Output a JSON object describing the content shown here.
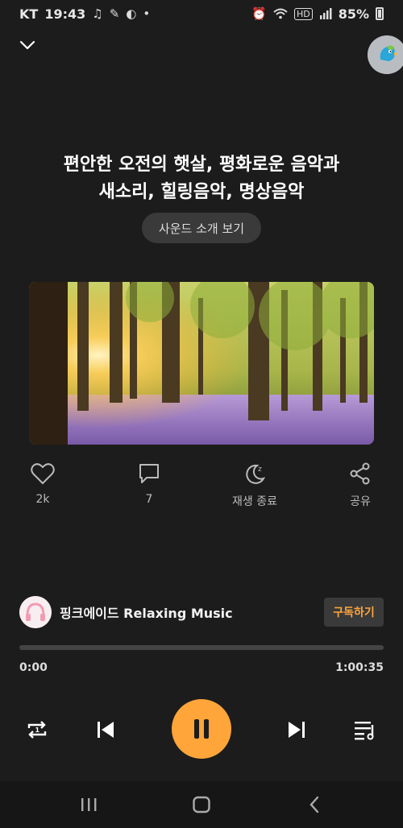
{
  "status_bar": {
    "carrier": "KT",
    "time": "19:43",
    "network": "HD",
    "battery": "85%"
  },
  "track": {
    "title_line1": "편안한 오전의 햇살, 평화로운 음악과",
    "title_line2": "새소리, 힐링음악, 명상음악",
    "intro_label": "사운드 소개 보기"
  },
  "actions": {
    "like_count": "2k",
    "comment_count": "7",
    "sleep_timer_label": "재생 종료",
    "share_label": "공유"
  },
  "channel": {
    "name": "핑크에이드 Relaxing Music",
    "subscribe_label": "구독하기"
  },
  "player": {
    "current_time": "0:00",
    "total_time": "1:00:35",
    "progress": 0.0
  },
  "colors": {
    "accent": "#ffa53a",
    "background": "#1c1c1c"
  }
}
